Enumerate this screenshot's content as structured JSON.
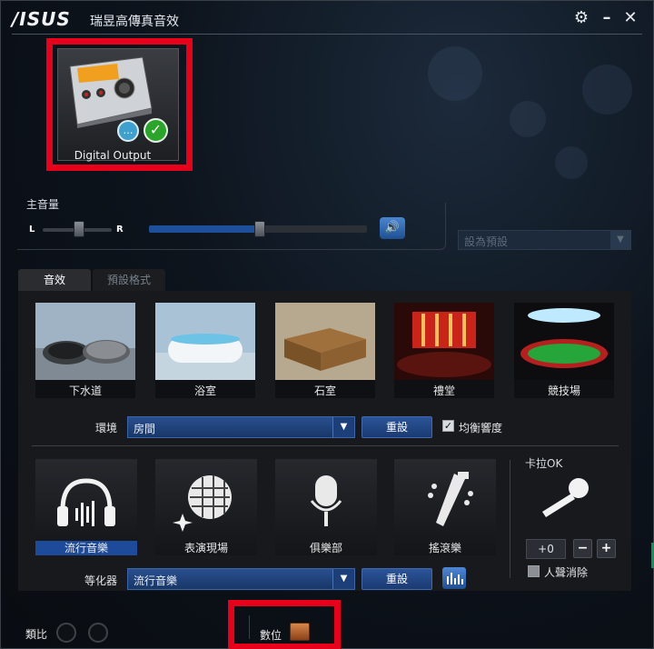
{
  "window": {
    "logo": "/ISUS",
    "title": "瑞昱高傳真音效"
  },
  "device": {
    "label": "Digital Output"
  },
  "volume": {
    "label": "主音量",
    "left": "L",
    "right": "R",
    "preset_placeholder": "設為預設"
  },
  "tabs": [
    {
      "label": "音效"
    },
    {
      "label": "預設格式"
    }
  ],
  "environments": [
    {
      "label": "下水道"
    },
    {
      "label": "浴室"
    },
    {
      "label": "石室"
    },
    {
      "label": "禮堂"
    },
    {
      "label": "競技場"
    }
  ],
  "environment_row": {
    "label": "環境",
    "value": "房間",
    "reset": "重設",
    "equalize_label": "均衡響度",
    "equalize_checked": true
  },
  "equalizers": [
    {
      "label": "流行音樂",
      "active": true
    },
    {
      "label": "表演現場",
      "active": false
    },
    {
      "label": "俱樂部",
      "active": false
    },
    {
      "label": "搖滾樂",
      "active": false
    }
  ],
  "equalizer_row": {
    "label": "等化器",
    "value": "流行音樂",
    "reset": "重設"
  },
  "karaoke": {
    "title": "卡拉OK",
    "value": "+0",
    "minus": "−",
    "plus": "+",
    "vocal_cancel": "人聲消除"
  },
  "footer": {
    "analog_label": "類比",
    "digital_label": "數位"
  },
  "colors": {
    "accent_blue": "#1d4b9a",
    "highlight_red": "#e8001a"
  }
}
